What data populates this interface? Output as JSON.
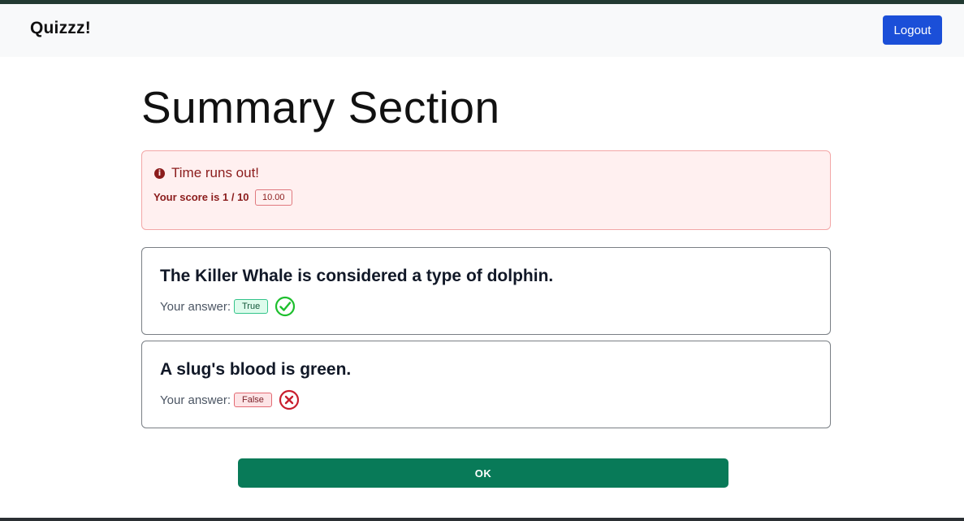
{
  "navbar": {
    "brand": "Quizzz!",
    "logout_label": "Logout"
  },
  "summary": {
    "title": "Summary Section",
    "alert_message": "Time runs out!",
    "score_text": "Your score is 1 / 10",
    "score_badge": "10.00"
  },
  "questions": [
    {
      "text": "The Killer Whale is considered a type of dolphin.",
      "answer_label": "Your answer:",
      "answer": "True",
      "result_icon": "check-circle-icon"
    },
    {
      "text": "A slug's blood is green.",
      "answer_label": "Your answer:",
      "answer": "False",
      "result_icon": "x-circle-icon"
    }
  ],
  "ok_label": "OK",
  "colors": {
    "brand_bar": "#223a32",
    "primary_button": "#1b4fd8",
    "success_button": "#087a58",
    "correct": "#1dbf2d",
    "incorrect": "#c81e2d"
  }
}
